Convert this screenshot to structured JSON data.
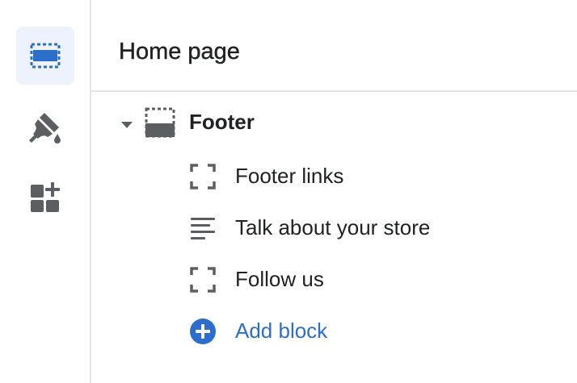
{
  "colors": {
    "accent": "#2c6ecb",
    "icon_gray": "#5c5f62",
    "active_bg": "#edf2fc",
    "divider": "#e3e3e3",
    "text": "#202223"
  },
  "rail": {
    "items": [
      {
        "icon": "sections-icon",
        "active": true
      },
      {
        "icon": "theme-settings-paintbrush-icon",
        "active": false
      },
      {
        "icon": "app-embeds-icon",
        "active": false
      }
    ]
  },
  "header": {
    "title": "Home page"
  },
  "section": {
    "label": "Footer",
    "expanded": true,
    "icon": "footer-section-icon"
  },
  "blocks": [
    {
      "label": "Footer links",
      "icon": "dashed-block-icon"
    },
    {
      "label": "Talk about your store",
      "icon": "text-lines-icon"
    },
    {
      "label": "Follow us",
      "icon": "dashed-block-icon"
    }
  ],
  "add_block": {
    "label": "Add block",
    "icon": "plus-circle-icon"
  }
}
